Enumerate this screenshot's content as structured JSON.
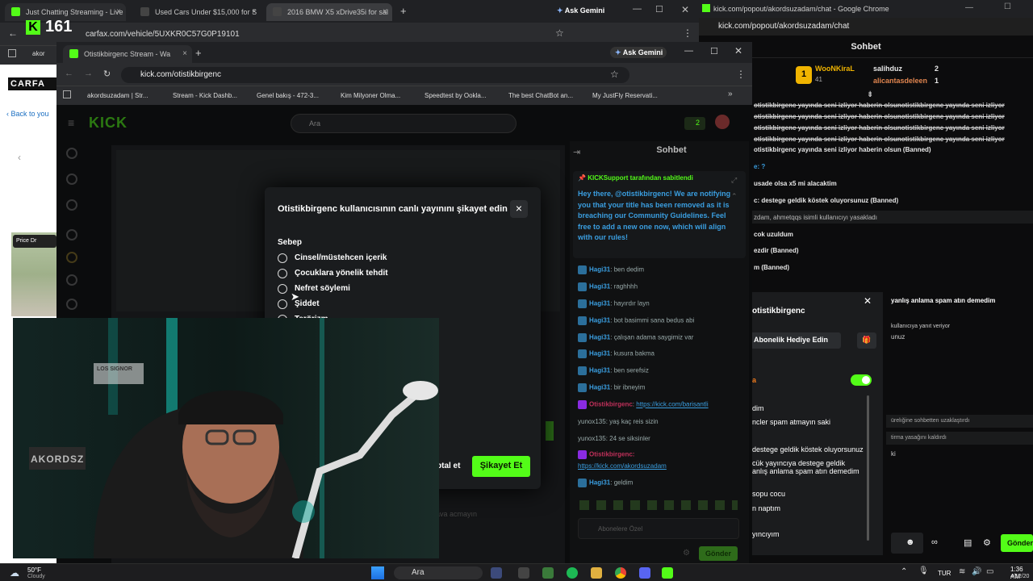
{
  "bg_browser": {
    "tabs": [
      "Just Chatting Streaming - Live",
      "Used Cars Under $15,000 for S",
      "2016 BMW X5 xDrive35i for sal"
    ],
    "ask_gemini": "Ask Gemini",
    "address": "carfax.com/vehicle/5UXKR0C57G0P19101",
    "kick_counter": "161",
    "bookmark_first": "akor",
    "carfax_logo": "CARFA",
    "back_link": "Back to you",
    "price_drop": "Price Dr"
  },
  "right_window": {
    "title": "kick.com/popout/akordsuzadam/chat - Google Chrome",
    "url": "kick.com/popout/akordsuzadam/chat",
    "header": "Sohbet",
    "leaderboard": {
      "first_user": "WooNKiraL",
      "first_count": "41",
      "second_user": "salihduz",
      "second_count": "2",
      "third_user": "alicantasdeleen",
      "third_count": "1"
    },
    "chat_lines": [
      "otistikbirgenc yayında seni izliyor haberin olsunotistikbirgenc yayında seni izliyor",
      "otistikbirgenc yayında seni izliyor haberin olsunotistikbirgenc yayında seni izliyor",
      "otistikbirgenc yayında seni izliyor haberin olsunotistikbirgenc yayında seni izliyor",
      "otistikbirgenc yayında seni izliyor haberin olsunotistikbirgenc yayında seni izliyor",
      "otistikbirgenc yayında seni izliyor haberin olsun (Banned)",
      "e: ?",
      "usade olsa x5 mi alacaktim",
      "c: destege geldik köstek oluyorsunuz (Banned)",
      "zdam, ahmetqqs isimli kullanıcıyı yasakladı",
      "cok uzuldum",
      "ezdir (Banned)",
      "m (Banned)"
    ],
    "popup": {
      "username": "otistikbirgenc",
      "gift_button": "Abonelik Hediye Edin",
      "toggle_label": "a",
      "lines": [
        "dim",
        "ncler spam atmayın saki",
        "destege geldik köstek oluyorsunuz",
        "cük yayıncıya destege geldik",
        "anlış anlama spam atın demedim",
        "sopu cocu",
        "n naptım",
        "yıncıyım"
      ]
    },
    "side_lines": [
      "yanlış anlama spam atın demedim",
      "kullanıcıya yanıt veriyor",
      "unuz",
      "ürelığine sohbetten uzaklaştırdı",
      "tirma yasağını kaldırdı",
      "ki"
    ],
    "send_label": "Gönder"
  },
  "main_window": {
    "tab_title": "Otistikbirgenc Stream - Wa",
    "ask_gemini": "Ask Gemini",
    "address": "kick.com/otistikbirgenc",
    "bookmarks": [
      "akordsuzadam | Str...",
      "Stream - Kick Dashb...",
      "Genel bakış - 472-3...",
      "Kim Milyoner Olma...",
      "Speedtest by Ookla...",
      "The best ChatBot an...",
      "My JustFly Reservati..."
    ],
    "logo": "KICK",
    "search_placeholder": "Ara",
    "follow_count": "2",
    "chat_title": "Sohbet",
    "pinned_by": "KICKSupport tarafından sabitlendi",
    "pinned_text": "Hey there, @otistikbirgenc! We are notifying you that your title has been removed as it is breaching our Community Guidelines. Feel free to add a new one now, which will align with our rules!",
    "chat": [
      {
        "user": "Hagi31",
        "text": "ben dedim"
      },
      {
        "user": "Hagi31",
        "text": "raghhhh"
      },
      {
        "user": "Hagi31",
        "text": "hayırdır layn"
      },
      {
        "user": "Hagi31",
        "text": "bot basimmi sana bedus abi"
      },
      {
        "user": "Hagi31",
        "text": "çalışan adama saygimiz var"
      },
      {
        "user": "Hagi31",
        "text": "kusura bakma"
      },
      {
        "user": "Hagi31",
        "text": "ben serefsiz"
      },
      {
        "user": "Hagi31",
        "text": "bir ibneyim"
      }
    ],
    "otistik_link": "https://kick.com/barisantli",
    "otistik_user": "Otistikbirgenc",
    "yunox_1": "yunox135: yaş kaç reis sizin",
    "yunox_2": "yunox135: 24 se siksinler",
    "otistik_user2": "Otistikbirgenc:",
    "otistik_link2": "https://kick.com/akordsuzadam",
    "last_user": "Hagi31",
    "last_text": "geldim",
    "sub_placeholder": "Abonelere Özel",
    "send": "Gönder",
    "ghost_text": "ava acmayın"
  },
  "modal": {
    "title": "Otistikbirgenc kullanıcısının canlı yayınını şikayet edin",
    "section": "Sebep",
    "options": [
      "Cinsel/müstehcen içerik",
      "Çocuklara yönelik tehdit",
      "Nefret söylemi",
      "Şiddet",
      "Terörizm"
    ],
    "cancel": "ptal et",
    "submit": "Şikayet Et"
  },
  "webcam": {
    "sign_text": "AKORDSZ",
    "neon": "LOS SIGNOR"
  },
  "taskbar": {
    "weather_temp": "50°F",
    "weather_desc": "Cloudy",
    "search": "Ara",
    "lang": "TUR",
    "time": "1:36 AM",
    "date": "4/12/20"
  },
  "colors": {
    "kick_green": "#53fc18",
    "link_blue": "#3a9ee0"
  }
}
